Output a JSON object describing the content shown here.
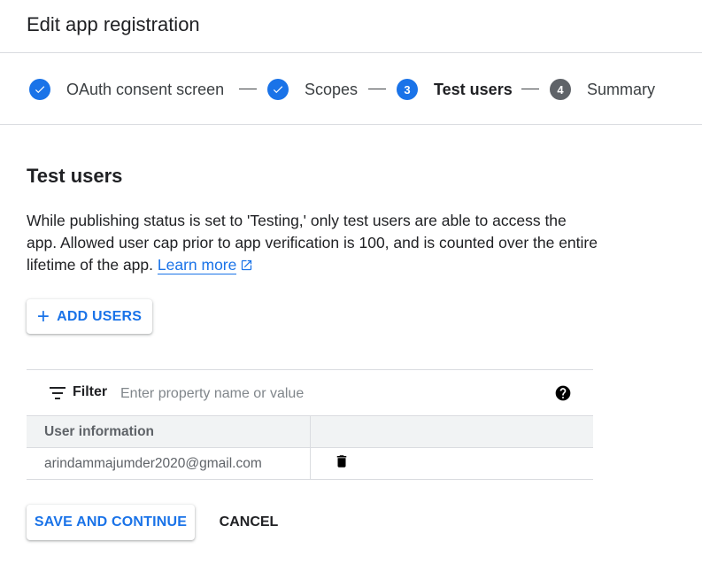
{
  "header": {
    "title": "Edit app registration"
  },
  "stepper": {
    "steps": [
      {
        "label": "OAuth consent screen",
        "state": "complete",
        "icon": "check-icon"
      },
      {
        "label": "Scopes",
        "state": "complete",
        "icon": "check-icon"
      },
      {
        "number": "3",
        "label": "Test users",
        "state": "current"
      },
      {
        "number": "4",
        "label": "Summary",
        "state": "pending"
      }
    ]
  },
  "section": {
    "title": "Test users",
    "description": "While publishing status is set to 'Testing,' only test users are able to access the app. Allowed user cap prior to app verification is 100, and is counted over the entire lifetime of the app.",
    "learn_more": "Learn more"
  },
  "add_users_button": {
    "label": "ADD USERS",
    "icon": "plus-icon"
  },
  "filter": {
    "label": "Filter",
    "placeholder": "Enter property name or value"
  },
  "table": {
    "columns": [
      "User information",
      ""
    ],
    "rows": [
      {
        "user": "arindammajumder2020@gmail.com",
        "action_icon": "trash-icon"
      }
    ]
  },
  "footer": {
    "save_label": "SAVE AND CONTINUE",
    "cancel_label": "CANCEL"
  },
  "colors": {
    "accent": "#1a73e8",
    "pending_step": "#5f6368",
    "divider": "#dadce0"
  }
}
